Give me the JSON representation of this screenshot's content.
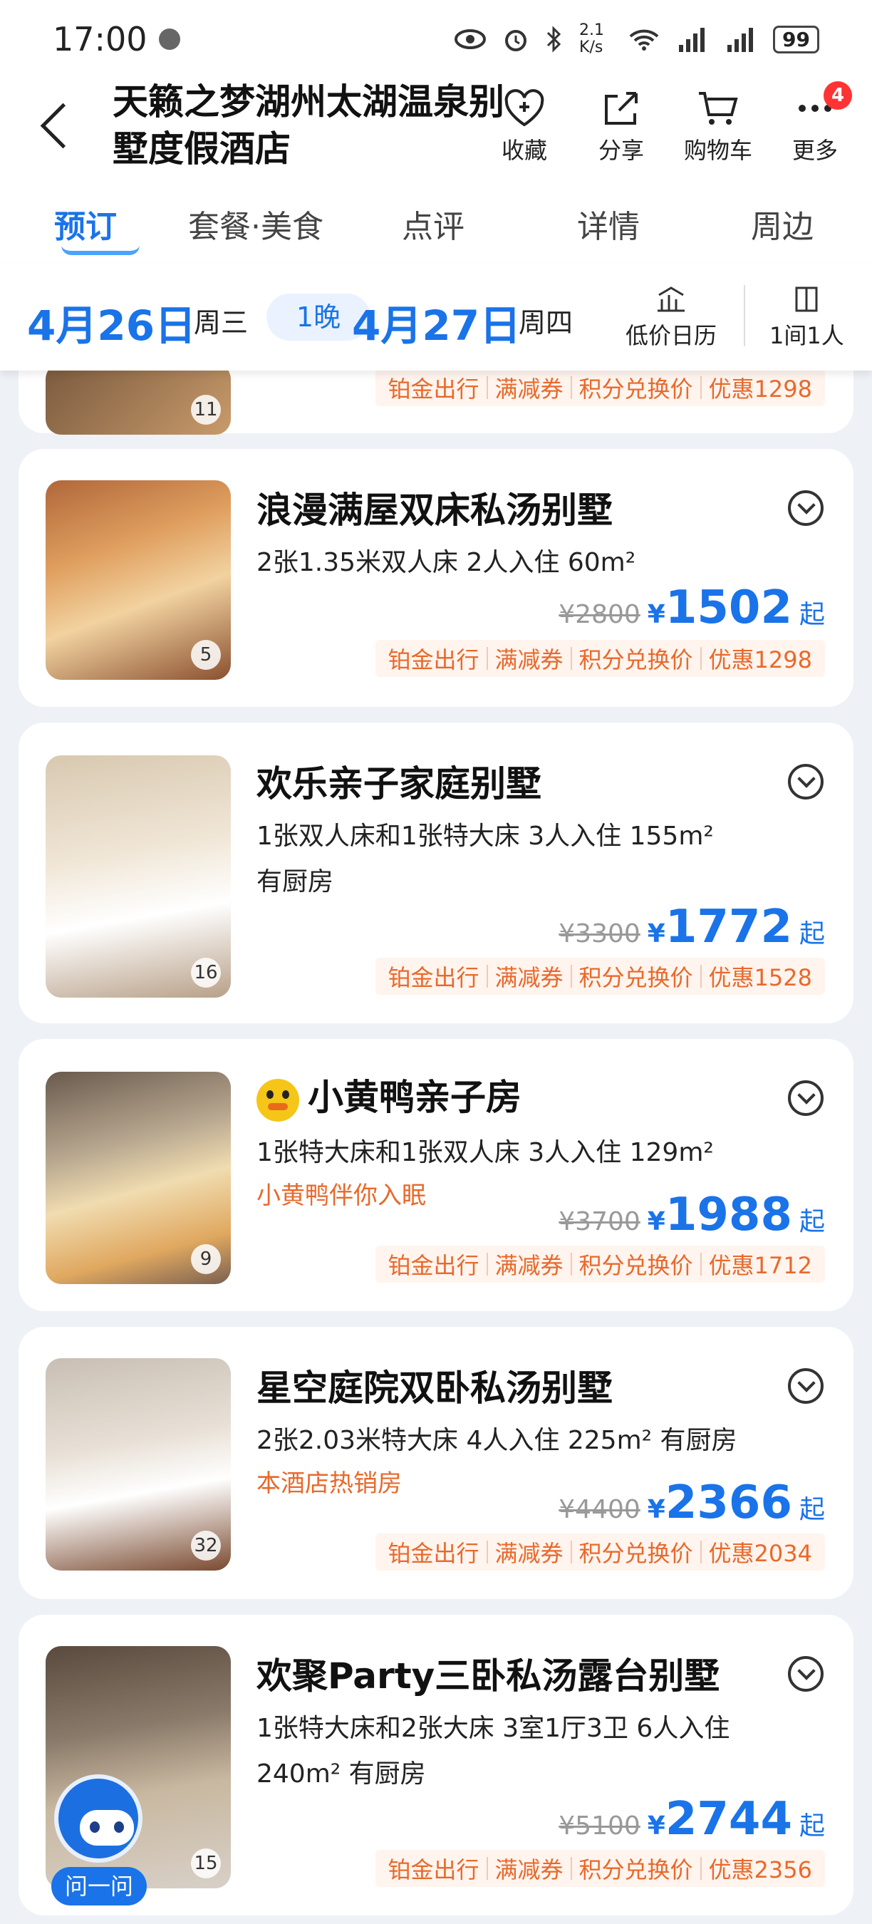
{
  "status": {
    "time": "17:00",
    "speed": "2.1 K/s",
    "battery": "99"
  },
  "header": {
    "hotel_name": "天籁之梦湖州太湖温泉别墅度假酒店",
    "actions": [
      {
        "label": "收藏",
        "icon": "heart-plus-icon"
      },
      {
        "label": "分享",
        "icon": "share-icon"
      },
      {
        "label": "购物车",
        "icon": "cart-icon"
      },
      {
        "label": "更多",
        "icon": "more-icon",
        "badge": "4"
      }
    ]
  },
  "tabs": [
    "预订",
    "套餐·美食",
    "点评",
    "详情",
    "周边"
  ],
  "datebar": {
    "checkin_date": "4月26日",
    "checkin_week": "周三",
    "nights": "1晚",
    "checkout_date": "4月27日",
    "checkout_week": "周四",
    "calendar_label": "低价日历",
    "rooms_label": "1间1人"
  },
  "promos_template": [
    "铂金出行",
    "满减券",
    "积分兑换价"
  ],
  "prev_card": {
    "count": "11",
    "discount": "优惠1298"
  },
  "rooms": [
    {
      "name": "浪漫满屋双床私汤别墅",
      "specs": "2张1.35米双人床  2人入住  60m²",
      "tagline": "",
      "old_price": "¥2800",
      "currency": "¥",
      "price": "1502",
      "suffix": "起",
      "discount": "优惠1298",
      "photo_count": "5"
    },
    {
      "name": "欢乐亲子家庭别墅",
      "specs": "1张双人床和1张特大床  3人入住  155m²",
      "specs2": "有厨房",
      "tagline": "",
      "old_price": "¥3300",
      "currency": "¥",
      "price": "1772",
      "suffix": "起",
      "discount": "优惠1528",
      "photo_count": "16"
    },
    {
      "name": "小黄鸭亲子房",
      "specs": "1张特大床和1张双人床  3人入住  129m²",
      "tagline": "小黄鸭伴你入眠",
      "old_price": "¥3700",
      "currency": "¥",
      "price": "1988",
      "suffix": "起",
      "discount": "优惠1712",
      "photo_count": "9"
    },
    {
      "name": "星空庭院双卧私汤别墅",
      "specs": "2张2.03米特大床  4人入住  225m²  有厨房",
      "tagline": "本酒店热销房",
      "old_price": "¥4400",
      "currency": "¥",
      "price": "2366",
      "suffix": "起",
      "discount": "优惠2034",
      "photo_count": "32"
    },
    {
      "name": "欢聚Party三卧私汤露台别墅",
      "specs": "1张特大床和2张大床  3室1厅3卫  6人入住",
      "specs2": "240m²  有厨房",
      "tagline": "",
      "old_price": "¥5100",
      "currency": "¥",
      "price": "2744",
      "suffix": "起",
      "discount": "优惠2356",
      "photo_count": "15"
    }
  ],
  "assistant": {
    "label": "问一问"
  },
  "colors": {
    "accent": "#1a73e8",
    "promo": "#e8692b"
  }
}
